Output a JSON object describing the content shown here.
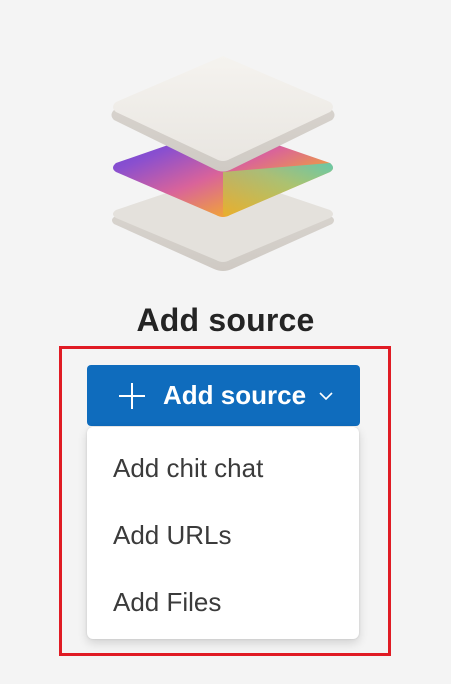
{
  "page": {
    "heading": "Add source"
  },
  "add_source_button": {
    "label": "Add source",
    "icon": "plus-icon",
    "dropdown_icon": "chevron-down-icon",
    "color": "#0f6cbd"
  },
  "menu": {
    "items": [
      {
        "label": "Add chit chat"
      },
      {
        "label": "Add URLs"
      },
      {
        "label": "Add Files"
      }
    ]
  },
  "highlight": {
    "color": "#e01b24"
  },
  "illustration": {
    "icon": "stacked-layers-icon"
  }
}
